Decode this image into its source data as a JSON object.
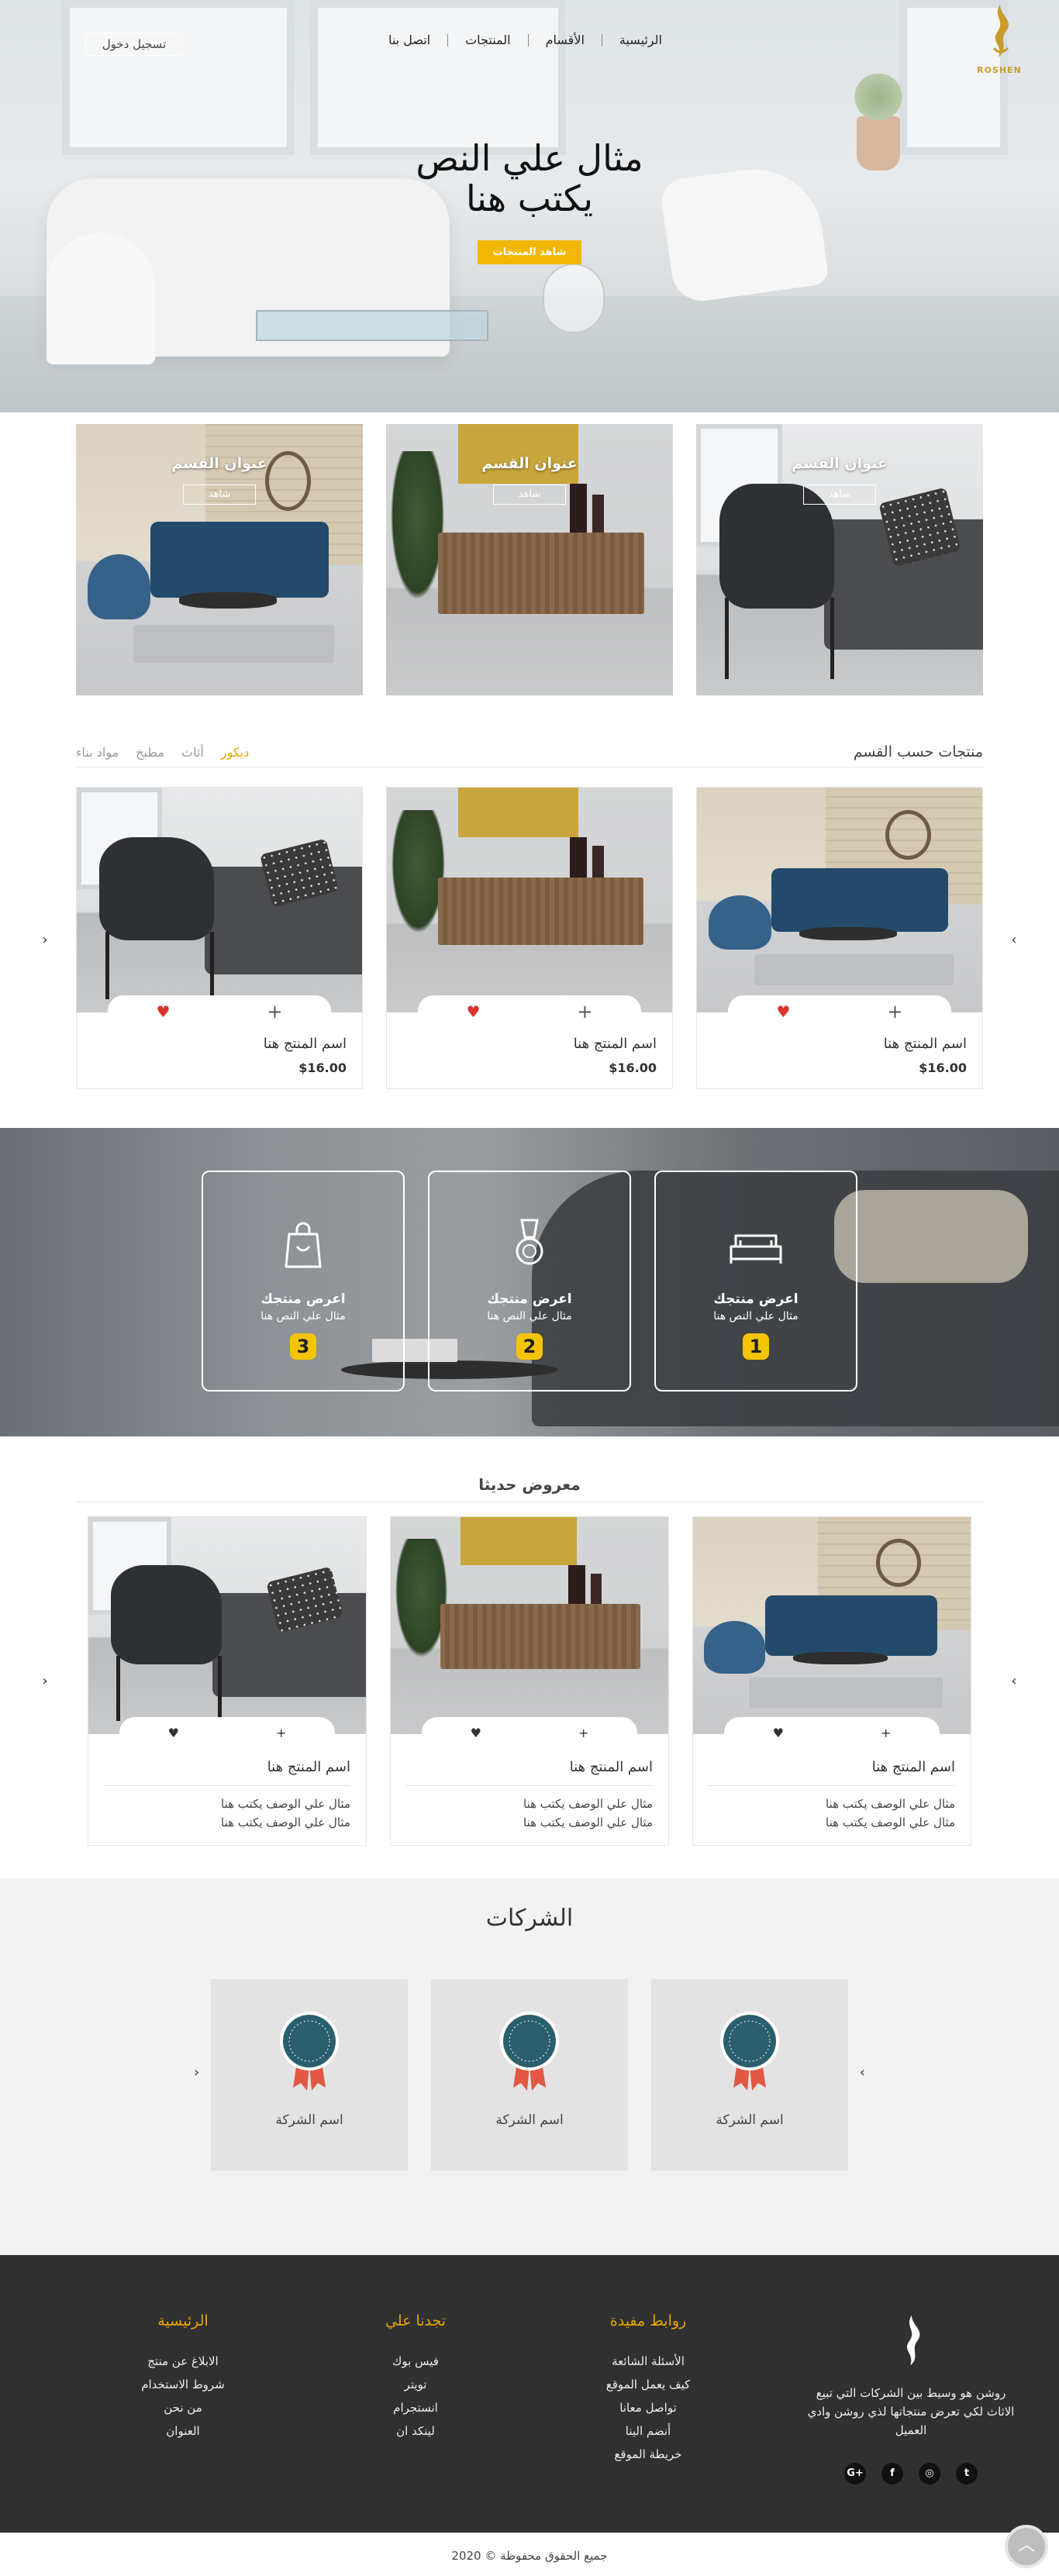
{
  "brand": {
    "name": "روشن",
    "latin": "ROSHEN",
    "accent": "#f2b705"
  },
  "nav": {
    "items": [
      "الرئيسية",
      "الأقسام",
      "المنتجات",
      "اتصل بنا"
    ],
    "login": "تسجيل دخول"
  },
  "hero": {
    "line1": "مثال علي النص",
    "line2": "يكتب هنا",
    "button": "شاهد المنتجات"
  },
  "categories": [
    {
      "title": "عنوان القسم",
      "button": "شاهد"
    },
    {
      "title": "عنوان القسم",
      "button": "شاهد"
    },
    {
      "title": "عنوان القسم",
      "button": "شاهد"
    }
  ],
  "by_category": {
    "title": "منتجات حسب القسم",
    "tabs": [
      "ديكور",
      "أثاث",
      "مطبخ",
      "مواد بناء"
    ],
    "active_tab": "ديكور"
  },
  "products": [
    {
      "name": "اسم المنتج هنا",
      "price": "$16.00"
    },
    {
      "name": "اسم المنتج هنا",
      "price": "$16.00"
    },
    {
      "name": "اسم المنتج هنا",
      "price": "$16.00"
    }
  ],
  "steps": [
    {
      "title": "اعرض منتجك",
      "text": "مثال علي النص هنا",
      "number": "1",
      "icon": "sofa-icon"
    },
    {
      "title": "اعرض منتجك",
      "text": "مثال علي النص هنا",
      "number": "2",
      "icon": "medal-icon"
    },
    {
      "title": "اعرض منتجك",
      "text": "مثال علي النص هنا",
      "number": "3",
      "icon": "shopping-bag-icon"
    }
  ],
  "new_offers": {
    "title": "معروض حديثا",
    "items": [
      {
        "name": "اسم المنتج هنا",
        "desc1": "مثال علي الوصف يكتب هنا",
        "desc2": "مثال علي الوصف يكتب هنا"
      },
      {
        "name": "اسم المنتج هنا",
        "desc1": "مثال علي الوصف يكتب هنا",
        "desc2": "مثال علي الوصف يكتب هنا"
      },
      {
        "name": "اسم المنتج هنا",
        "desc1": "مثال علي الوصف يكتب هنا",
        "desc2": "مثال علي الوصف يكتب هنا"
      }
    ]
  },
  "companies": {
    "title": "الشركات",
    "items": [
      "اسم الشركة",
      "اسم الشركة",
      "اسم الشركة"
    ]
  },
  "footer": {
    "about": "روشن هو وسيط بين الشركات التي تبيع الاثاث لكي تعرض منتجاتها لذي روشن وادي العميل",
    "links_title": "روابط مفيدة",
    "links": [
      "الأسئلة الشائعة",
      "كيف يعمل الموقع",
      "تواصل معانا",
      "أنضم الينا",
      "خريطة الموقع"
    ],
    "find_us_title": "تجدنا علي",
    "find_us": [
      "فيس بوك",
      "تويتر",
      "انستجرام",
      "لينكد ان"
    ],
    "home_title": "الرئيسية",
    "home_links": [
      "الابلاغ عن منتج",
      "شروط الاستخدام",
      "من نحن",
      "العنوان"
    ],
    "social": [
      "google-plus-icon",
      "facebook-icon",
      "instagram-icon",
      "twitter-icon"
    ],
    "copyright": "جميع الحقوق محفوظة © 2020"
  }
}
